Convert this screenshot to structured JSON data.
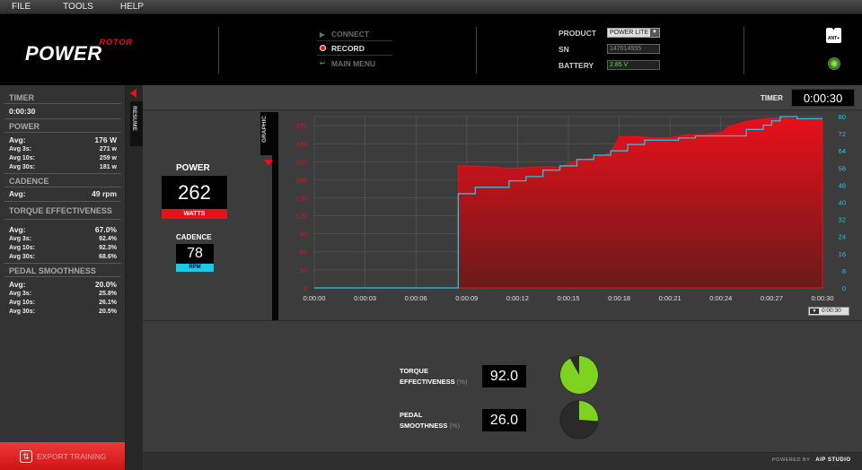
{
  "menu": {
    "file": "FILE",
    "tools": "TOOLS",
    "help": "HELP"
  },
  "header": {
    "logo_top": "ROTOR",
    "logo_main": "POWER",
    "controls": {
      "connect": "CONNECT",
      "record": "RECORD",
      "main_menu": "MAIN MENU"
    },
    "product_label": "PRODUCT",
    "product_value": "POWER LITE",
    "sn_label": "SN",
    "sn_value": "147014555",
    "battery_label": "BATTERY",
    "battery_value": "2.85 V",
    "ant_label": "ANT+"
  },
  "left": {
    "timer_title": "TIMER",
    "timer_value": "0:00:30",
    "power": {
      "title": "POWER",
      "avg_label": "Avg:",
      "avg_value": "176 W",
      "avg3_label": "Avg 3s:",
      "avg3_value": "271 w",
      "avg10_label": "Avg 10s:",
      "avg10_value": "259 w",
      "avg30_label": "Avg 30s:",
      "avg30_value": "181 w"
    },
    "cadence": {
      "title": "CADENCE",
      "avg_label": "Avg:",
      "avg_value": "49 rpm"
    },
    "torque": {
      "title": "TORQUE EFFECTIVENESS",
      "avg_label": "Avg:",
      "avg_value": "67.0%",
      "avg3_label": "Avg 3s:",
      "avg3_value": "92.4%",
      "avg10_label": "Avg 10s:",
      "avg10_value": "92.3%",
      "avg30_label": "Avg 30s:",
      "avg30_value": "68.6%"
    },
    "smooth": {
      "title": "PEDAL SMOOTHNESS",
      "avg_label": "Avg:",
      "avg_value": "20.0%",
      "avg3_label": "Avg 3s:",
      "avg3_value": "25.8%",
      "avg10_label": "Avg 10s:",
      "avg10_value": "26.1%",
      "avg30_label": "Avg 30s:",
      "avg30_value": "20.5%"
    },
    "export_label": "EXPORT TRAINING"
  },
  "resume_tab": "RESUME",
  "graphic_tab": "GRAPHIC",
  "main": {
    "timer_label": "TIMER",
    "timer_value": "0:00:30",
    "power_title": "POWER",
    "power_value": "262",
    "power_unit": "WATTS",
    "cadence_title": "CADENCE",
    "cadence_value": "78",
    "cadence_unit": "RPM",
    "range_value": "0:00:30",
    "torque_label_1": "TORQUE",
    "torque_label_2": "EFFECTIVENESS",
    "torque_pct": "(%)",
    "torque_value": "92.0",
    "torque_fraction": 0.92,
    "smooth_label_1": "PEDAL",
    "smooth_label_2": "SMOOTHNESS",
    "smooth_pct": "(%)",
    "smooth_value": "26.0",
    "smooth_fraction": 0.26
  },
  "footer": {
    "powered_by": "POWERED BY",
    "studio": "AIP STUDIO"
  },
  "colors": {
    "power": "#e8101a",
    "cadence": "#1cc8e8",
    "gauge": "#7ed321"
  },
  "chart_data": {
    "type": "area",
    "x_ticks": [
      "0:00:00",
      "0:00:03",
      "0:00:06",
      "0:00:09",
      "0:00:12",
      "0:00:15",
      "0:00:18",
      "0:00:21",
      "0:00:24",
      "0:00:27",
      "0:00:30"
    ],
    "xlim": [
      0,
      30
    ],
    "y_left_ticks": [
      0,
      30,
      60,
      90,
      120,
      150,
      180,
      210,
      240,
      270
    ],
    "ylim_left": [
      0,
      285
    ],
    "y_right_ticks": [
      0,
      8,
      16,
      24,
      32,
      40,
      48,
      56,
      64,
      72,
      80
    ],
    "ylim_right": [
      0,
      80
    ],
    "series": [
      {
        "axis": "left",
        "x": [
          0,
          8.5,
          8.5,
          9.5,
          10.5,
          11.5,
          12.5,
          13.5,
          14.5,
          15.5,
          16.5,
          17.5,
          18,
          19,
          20,
          21,
          22,
          23,
          24,
          24.5,
          25.5,
          26.5,
          27.5,
          28.5,
          29.5,
          30
        ],
        "values": [
          0,
          0,
          203,
          203,
          201,
          199,
          200,
          202,
          201,
          212,
          216,
          225,
          252,
          252,
          250,
          250,
          255,
          255,
          258,
          269,
          277,
          281,
          283,
          281,
          281,
          281
        ]
      },
      {
        "axis": "right",
        "x": [
          0,
          8.2,
          8.5,
          9.5,
          10.5,
          11.5,
          12.5,
          13.5,
          14.5,
          15.5,
          16.5,
          17.5,
          18.5,
          19.5,
          20.5,
          21.5,
          22.5,
          23.5,
          24.5,
          25.5,
          26.5,
          27,
          27.5,
          28.5,
          29.5,
          30
        ],
        "values": [
          0,
          0,
          44,
          47,
          47,
          50,
          52,
          55,
          57,
          60,
          62,
          64,
          67,
          69,
          69,
          70,
          71,
          71,
          71,
          74,
          76,
          78,
          80,
          79,
          79,
          79
        ]
      }
    ]
  }
}
